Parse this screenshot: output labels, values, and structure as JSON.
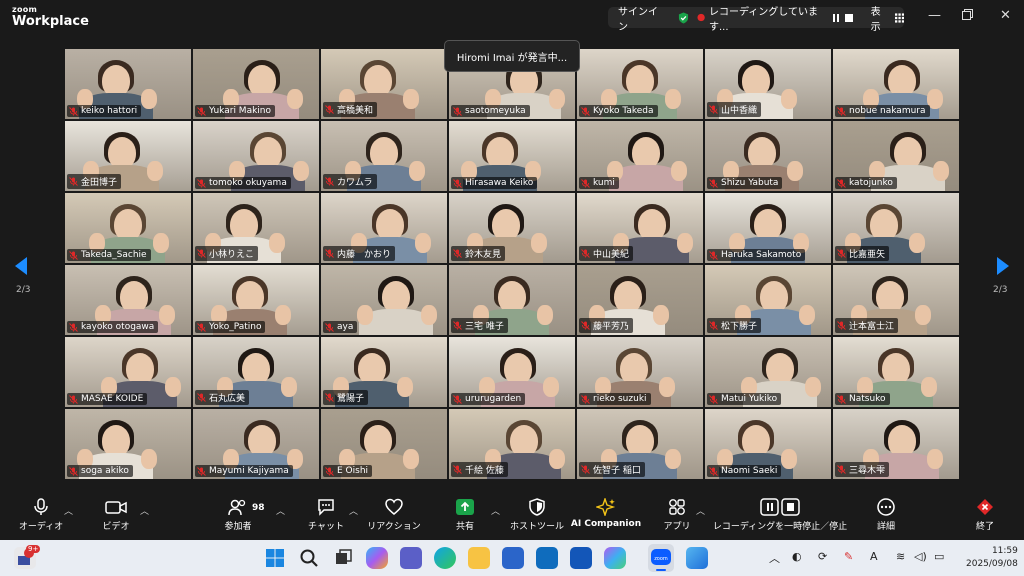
{
  "app": {
    "brand_top": "zoom",
    "brand_bottom": "Workplace"
  },
  "status": {
    "signin": "サインイン",
    "recording": "レコーディングしています...",
    "view": "表示"
  },
  "speaking": "Hiromi Imai が発言中...",
  "page_indicator": "2/3",
  "participants": [
    "keiko hattori",
    "Yukari Makino",
    "高橋美和",
    "saotomeyuka",
    "Kyoko Takeda",
    "山中香織",
    "nobue nakamura",
    "金田博子",
    "tomoko okuyama",
    "カワムラ",
    "Hirasawa Keiko",
    "kumi",
    "Shizu Yabuta",
    "katojunko",
    "Takeda_Sachie",
    "小林りえこ",
    "内藤　かおり",
    "鈴木友見",
    "中山美紀",
    "Haruka Sakamoto",
    "比嘉亜矢",
    "kayoko otogawa",
    "Yoko_Patino",
    "aya",
    "三宅 唯子",
    "藤平芳乃",
    "松下勝子",
    "辻本富士江",
    "MASAE KOIDE",
    "石丸広美",
    "鷺陽子",
    "ururugarden",
    "rieko suzuki",
    "Matui Yukiko",
    "Natsuko",
    "soga akiko",
    "Mayumi Kajiyama",
    "E Oishi",
    "千絵 佐藤",
    "佐智子 稲口",
    "Naomi Saeki",
    "三尋木雫"
  ],
  "toolbar": {
    "audio": "オーディオ",
    "video": "ビデオ",
    "participants": "参加者",
    "participants_count": "98",
    "chat": "チャット",
    "reactions": "リアクション",
    "share": "共有",
    "host_tools": "ホストツール",
    "ai_companion": "AI Companion",
    "apps": "アプリ",
    "pause_stop_recording": "レコーディングを一時停止／停止",
    "more": "詳細",
    "end": "終了"
  },
  "taskbar": {
    "time": "11:59",
    "date": "2025/09/08",
    "notif_badge": "9+"
  },
  "colors": {
    "accent_blue": "#1c8cff",
    "end_red": "#e02828",
    "share_green": "#1aa34a",
    "mic_off_red": "#e02828"
  }
}
